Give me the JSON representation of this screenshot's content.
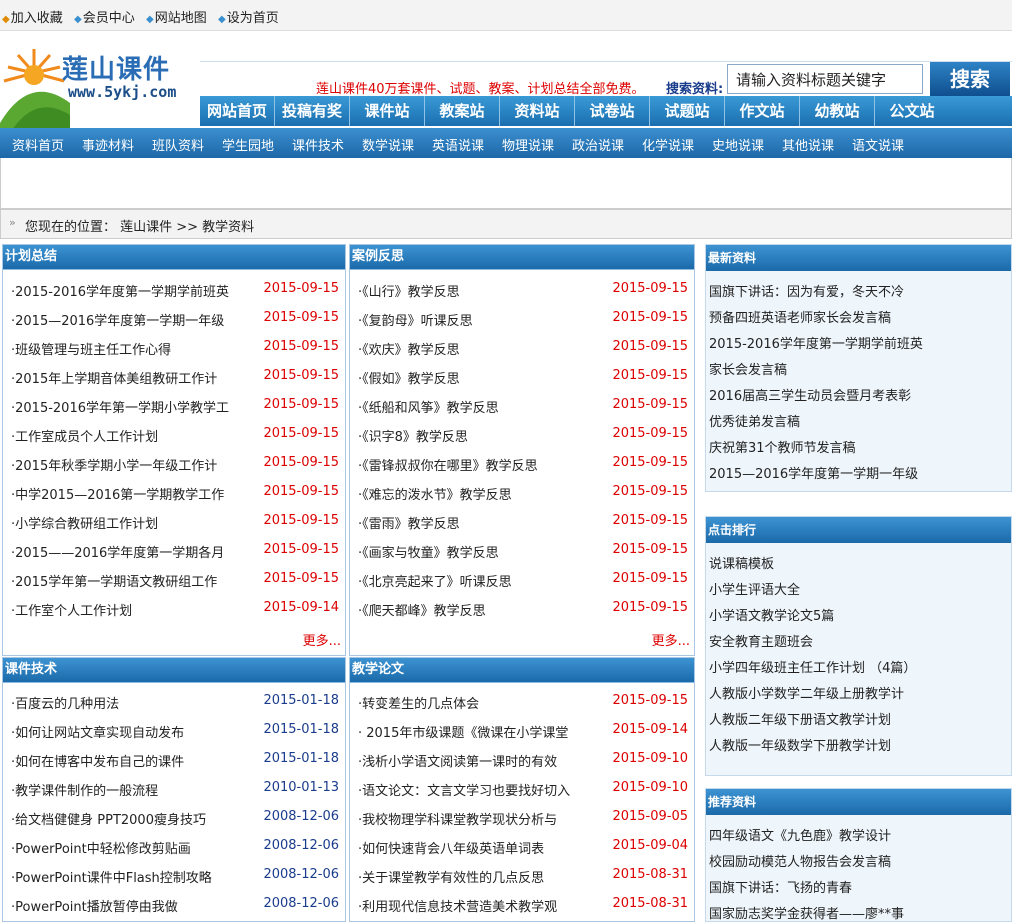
{
  "topbar": {
    "links": [
      "加入收藏",
      "会员中心",
      "网站地图",
      "设为首页"
    ]
  },
  "logo": {
    "title": "莲山课件",
    "url_text": "www.5ykj.com"
  },
  "header": {
    "notice": "莲山课件40万套课件、试题、教案、计划总结全部免费。",
    "search_label": "搜索资料:",
    "search_value": "请输入资料标题关键字",
    "search_button": "搜索"
  },
  "main_nav": [
    "网站首页",
    "投稿有奖",
    "课件站",
    "教案站",
    "资料站",
    "试卷站",
    "试题站",
    "作文站",
    "幼教站",
    "公文站"
  ],
  "sub_nav": [
    "资料首页",
    "事迹材料",
    "班队资料",
    "学生园地",
    "课件技术",
    "数学说课",
    "英语说课",
    "物理说课",
    "政治说课",
    "化学说课",
    "史地说课",
    "其他说课",
    "语文说课"
  ],
  "breadcrumb": "您现在的位置： 莲山课件 >> 教学资料",
  "boxes": {
    "plan": {
      "title": "计划总结",
      "more": "更多...",
      "items": [
        {
          "t": "·2015-2016学年度第一学期学前班英",
          "d": "2015-09-15"
        },
        {
          "t": "·2015—2016学年度第一学期一年级",
          "d": "2015-09-15"
        },
        {
          "t": "·班级管理与班主任工作心得",
          "d": "2015-09-15"
        },
        {
          "t": "·2015年上学期音体美组教研工作计",
          "d": "2015-09-15"
        },
        {
          "t": "·2015-2016学年第一学期小学教学工",
          "d": "2015-09-15"
        },
        {
          "t": "·工作室成员个人工作计划",
          "d": "2015-09-15"
        },
        {
          "t": "·2015年秋季学期小学一年级工作计",
          "d": "2015-09-15"
        },
        {
          "t": "·中学2015—2016第一学期教学工作",
          "d": "2015-09-15"
        },
        {
          "t": "·小学综合教研组工作计划",
          "d": "2015-09-15"
        },
        {
          "t": "·2015——2016学年度第一学期各月",
          "d": "2015-09-15"
        },
        {
          "t": "·2015学年第一学期语文教研组工作",
          "d": "2015-09-15"
        },
        {
          "t": "·工作室个人工作计划",
          "d": "2015-09-14"
        }
      ]
    },
    "case": {
      "title": "案例反思",
      "more": "更多...",
      "items": [
        {
          "t": "·《山行》教学反思",
          "d": "2015-09-15"
        },
        {
          "t": "·《复韵母》听课反思",
          "d": "2015-09-15"
        },
        {
          "t": "·《欢庆》教学反思",
          "d": "2015-09-15"
        },
        {
          "t": "·《假如》教学反思",
          "d": "2015-09-15"
        },
        {
          "t": "·《纸船和风筝》教学反思",
          "d": "2015-09-15"
        },
        {
          "t": "·《识字8》教学反思",
          "d": "2015-09-15"
        },
        {
          "t": "·《雷锋叔叔你在哪里》教学反思",
          "d": "2015-09-15"
        },
        {
          "t": "·《难忘的泼水节》教学反思",
          "d": "2015-09-15"
        },
        {
          "t": "·《雷雨》教学反思",
          "d": "2015-09-15"
        },
        {
          "t": "·《画家与牧童》教学反思",
          "d": "2015-09-15"
        },
        {
          "t": "·《北京亮起来了》听课反思",
          "d": "2015-09-15"
        },
        {
          "t": "·《爬天都峰》教学反思",
          "d": "2015-09-15"
        }
      ]
    },
    "tech": {
      "title": "课件技术",
      "items": [
        {
          "t": "·百度云的几种用法",
          "d": "2015-01-18"
        },
        {
          "t": "·如何让网站文章实现自动发布",
          "d": "2015-01-18"
        },
        {
          "t": "·如何在博客中发布自己的课件",
          "d": "2015-01-18"
        },
        {
          "t": "·教学课件制作的一般流程",
          "d": "2010-01-13"
        },
        {
          "t": "·给文档健健身 PPT2000瘦身技巧",
          "d": "2008-12-06"
        },
        {
          "t": "·PowerPoint中轻松修改剪贴画",
          "d": "2008-12-06"
        },
        {
          "t": "·PowerPoint课件中Flash控制攻略",
          "d": "2008-12-06"
        },
        {
          "t": "·PowerPoint播放暂停由我做",
          "d": "2008-12-06"
        }
      ]
    },
    "paper": {
      "title": "教学论文",
      "items": [
        {
          "t": "·转变差生的几点体会",
          "d": "2015-09-15"
        },
        {
          "t": "· 2015年市级课题《微课在小学课堂",
          "d": "2015-09-14"
        },
        {
          "t": "·浅析小学语文阅读第一课时的有效",
          "d": "2015-09-10"
        },
        {
          "t": "·语文论文：文言文学习也要找好切入",
          "d": "2015-09-10"
        },
        {
          "t": "·我校物理学科课堂教学现状分析与",
          "d": "2015-09-05"
        },
        {
          "t": "·如何快速背会八年级英语单词表",
          "d": "2015-09-04"
        },
        {
          "t": "·关于课堂教学有效性的几点反思",
          "d": "2015-08-31"
        },
        {
          "t": "·利用现代信息技术营造美术教学观",
          "d": "2015-08-31"
        }
      ]
    }
  },
  "side": {
    "latest": {
      "title": "最新资料",
      "items": [
        "国旗下讲话：因为有爱，冬天不冷",
        "预备四班英语老师家长会发言稿",
        "2015-2016学年度第一学期学前班英",
        "家长会发言稿",
        "2016届高三学生动员会暨月考表彰",
        "优秀徒弟发言稿",
        "庆祝第31个教师节发言稿",
        "2015—2016学年度第一学期一年级"
      ]
    },
    "hot": {
      "title": "点击排行",
      "items": [
        "说课稿模板",
        "小学生评语大全",
        "小学语文教学论文5篇",
        "安全教育主题班会",
        "小学四年级班主任工作计划 （4篇）",
        "人教版小学数学二年级上册教学计",
        "人教版二年级下册语文教学计划",
        "人教版一年级数学下册教学计划"
      ]
    },
    "recommend": {
      "title": "推荐资料",
      "items": [
        "四年级语文《九色鹿》教学设计",
        "校园励动模范人物报告会发言稿",
        "国旗下讲话：飞扬的青春",
        "国家励志奖学金获得者——廖**事"
      ]
    }
  },
  "colors": {
    "date_red": "#dd0000",
    "date_blue": "#1a3c8c",
    "nav_blue": "#1b6aaa"
  }
}
